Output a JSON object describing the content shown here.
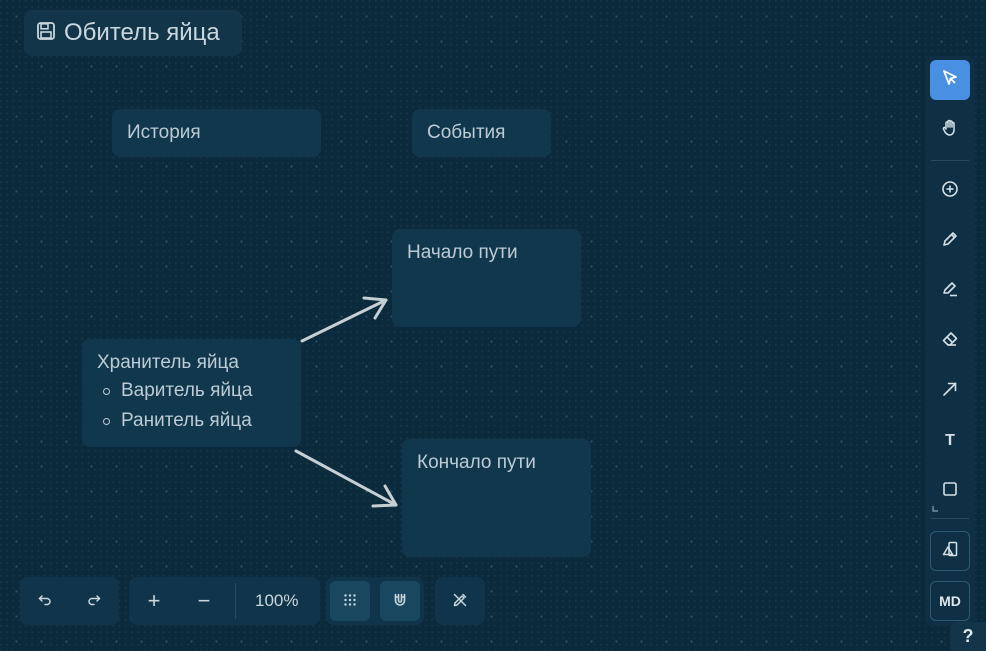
{
  "board": {
    "title": "Обитель яйца",
    "title_icon": "save-icon"
  },
  "cards": {
    "history": "История",
    "events": "События",
    "start": "Начало пути",
    "end": "Кончало пути",
    "keeper": {
      "heading": "Хранитель яйца",
      "items": [
        "Варитель яйца",
        "Ранитель яйца"
      ]
    }
  },
  "toolbar": {
    "tools": [
      {
        "icon": "select-cursor-icon",
        "active": true
      },
      {
        "icon": "hand-icon"
      },
      {
        "icon": "plus-circle-icon"
      },
      {
        "icon": "pen-icon"
      },
      {
        "icon": "marker-icon"
      },
      {
        "icon": "eraser-icon"
      },
      {
        "icon": "arrow-icon"
      },
      {
        "icon": "text-icon",
        "label": "T"
      },
      {
        "icon": "rectangle-icon"
      },
      {
        "icon": "shapes-icon"
      },
      {
        "icon": "markdown-icon",
        "label": "MD"
      }
    ],
    "accent_color": "#4a90e2"
  },
  "bottom": {
    "undo_icon": "undo-icon",
    "redo_icon": "redo-icon",
    "zoom_in": "+",
    "zoom_out": "−",
    "zoom_level": "100%",
    "grid_icon": "grid-icon",
    "snap_icon": "magnet-icon",
    "tools_icon": "ruler-pencil-icon"
  },
  "help": "?",
  "colors": {
    "background": "#0b2a3c",
    "card": "#11374d",
    "arrow": "#c5d0d5"
  }
}
